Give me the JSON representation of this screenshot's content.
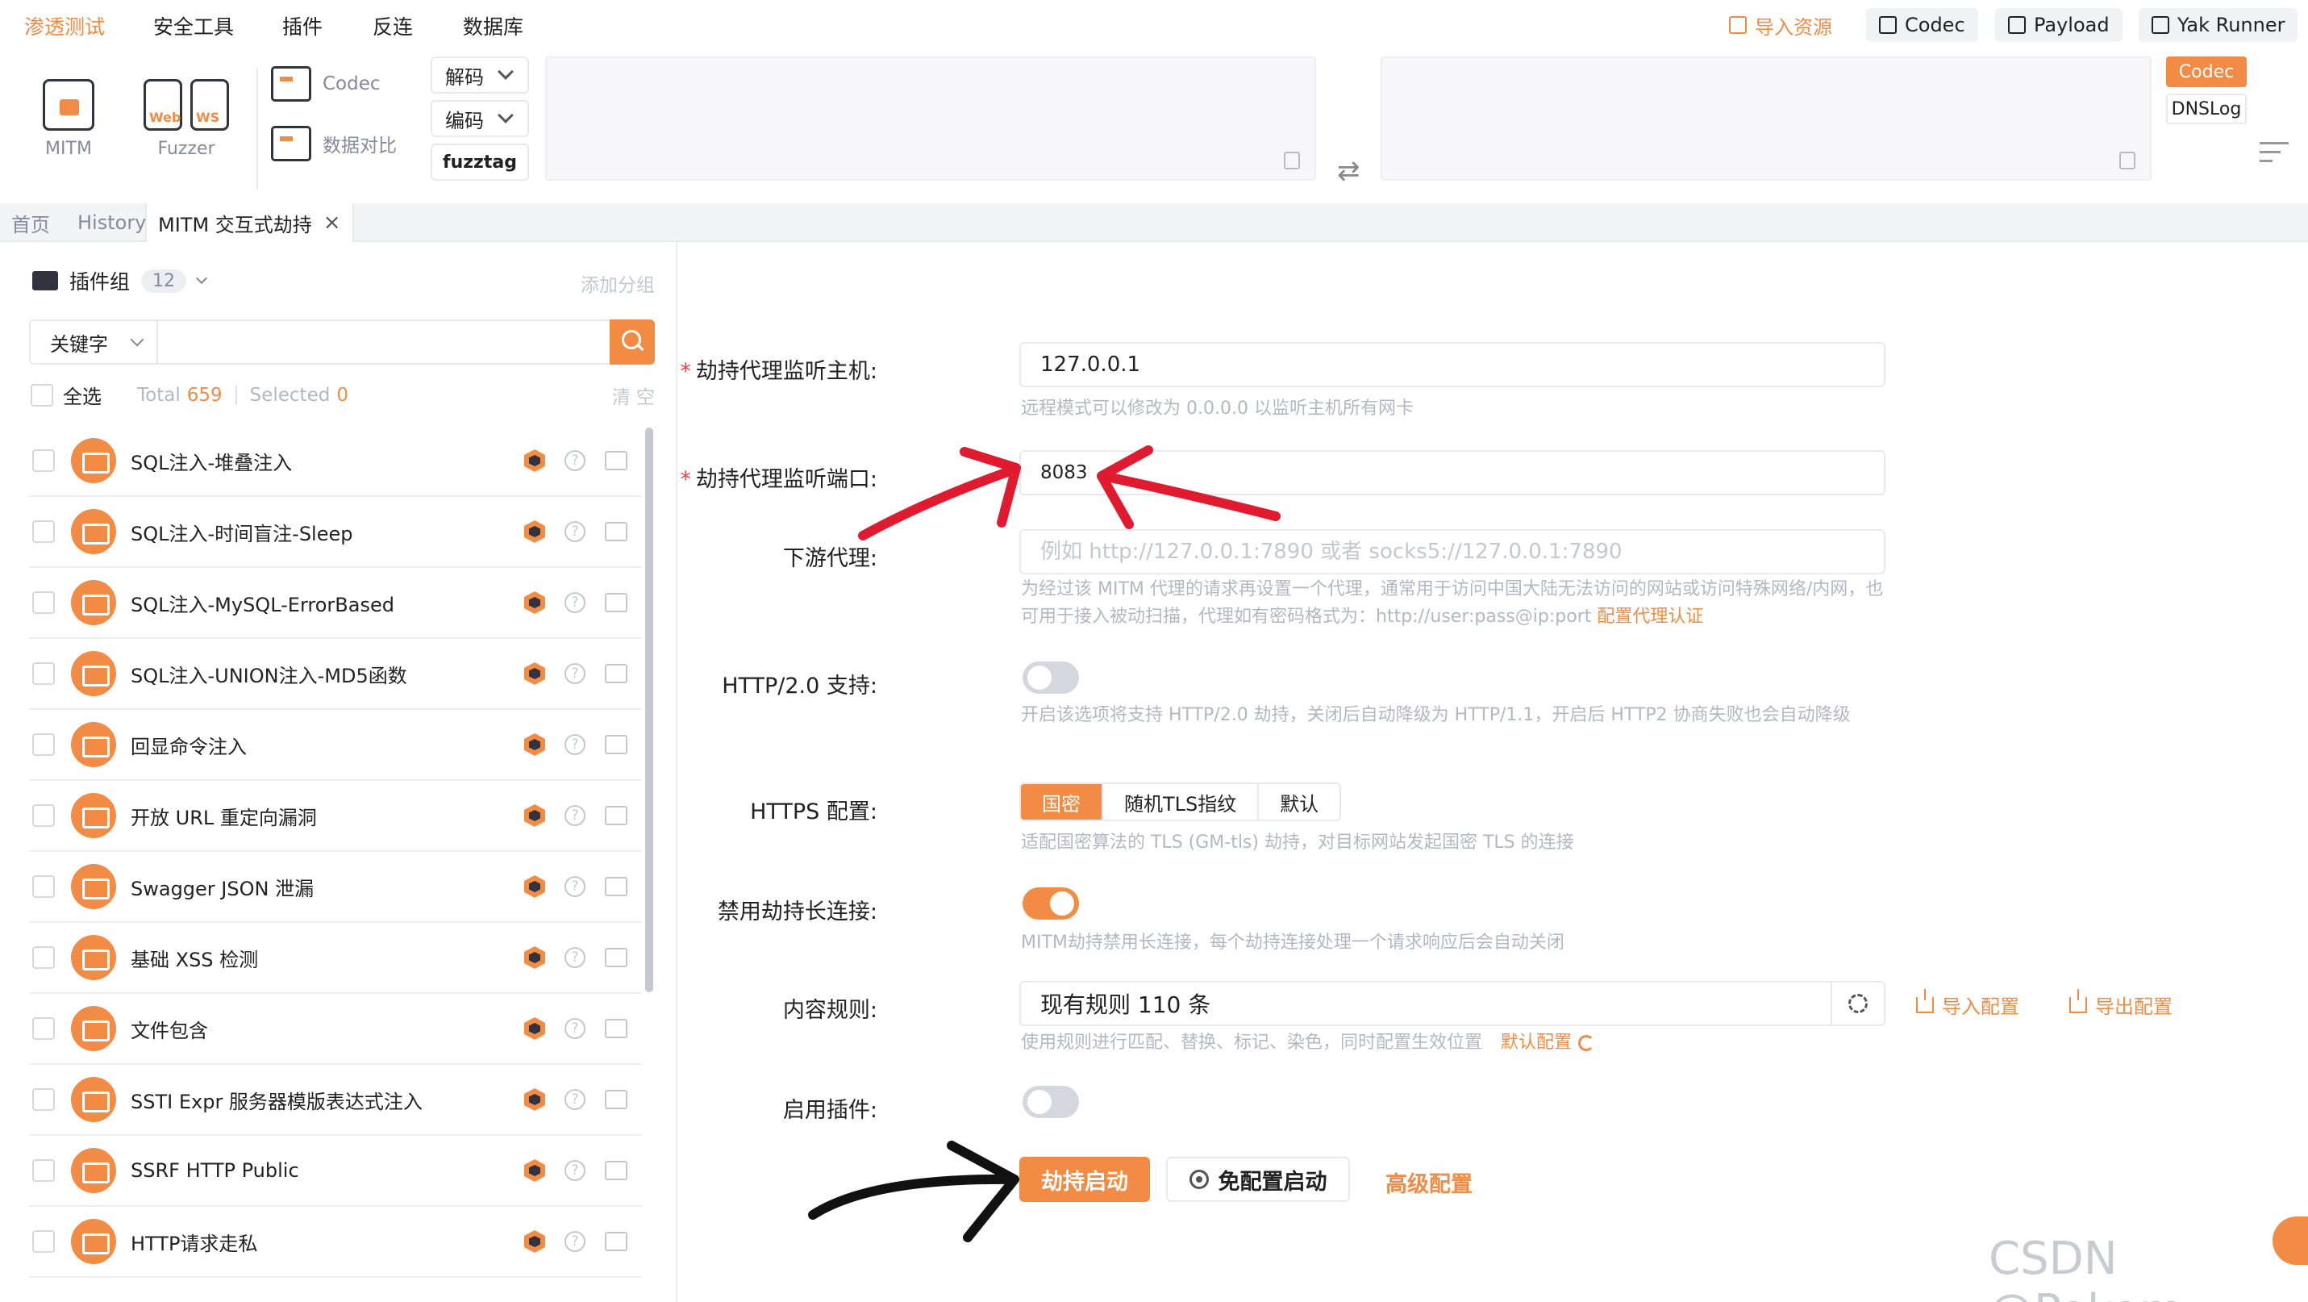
{
  "topnav": {
    "menus": [
      "渗透测试",
      "安全工具",
      "插件",
      "反连",
      "数据库"
    ],
    "quick": {
      "import": "导入资源",
      "codec": "Codec",
      "payload": "Payload",
      "yak_runner": "Yak Runner"
    }
  },
  "toolbar": {
    "mitm": "MITM",
    "fuzzer": "Fuzzer",
    "web_tag": "Web",
    "ws_tag": "WS",
    "codec": "Codec",
    "compare": "数据对比",
    "decode": "解码",
    "encode": "编码",
    "fuzztag": "fuzztag",
    "right_codec": "Codec",
    "right_dnslog": "DNSLog"
  },
  "tabs": {
    "home": "首页",
    "history": "History",
    "mitm": "MITM 交互式劫持",
    "close": "×"
  },
  "plugins": {
    "group_label": "插件组",
    "group_count": "12",
    "add_group": "添加分组",
    "search_type": "关键字",
    "search_value": "",
    "select_all": "全选",
    "total_label": "Total",
    "total": "659",
    "selected_label": "Selected",
    "selected": "0",
    "clear": "清 空",
    "items": [
      "SQL注入-堆叠注入",
      "SQL注入-时间盲注-Sleep",
      "SQL注入-MySQL-ErrorBased",
      "SQL注入-UNION注入-MD5函数",
      "回显命令注入",
      "开放 URL 重定向漏洞",
      "Swagger JSON 泄漏",
      "基础 XSS 检测",
      "文件包含",
      "SSTI Expr 服务器模版表达式注入",
      "SSRF HTTP Public",
      "HTTP请求走私"
    ]
  },
  "form": {
    "host_label": "劫持代理监听主机:",
    "host_value": "127.0.0.1",
    "host_help": "远程模式可以修改为 0.0.0.0 以监听主机所有网卡",
    "port_label": "劫持代理监听端口:",
    "port_value": "8083",
    "downstream_label": "下游代理:",
    "downstream_placeholder": "例如 http://127.0.0.1:7890 或者 socks5://127.0.0.1:7890",
    "downstream_help": "为经过该 MITM 代理的请求再设置一个代理，通常用于访问中国大陆无法访问的网站或访问特殊网络/内网，也可用于接入被动扫描，代理如有密码格式为：http://user:pass@ip:port",
    "downstream_link": "配置代理认证",
    "http2_label": "HTTP/2.0 支持:",
    "http2_help": "开启该选项将支持 HTTP/2.0 劫持，关闭后自动降级为 HTTP/1.1，开启后 HTTP2 协商失败也会自动降级",
    "https_label": "HTTPS 配置:",
    "https_options": [
      "国密",
      "随机TLS指纹",
      "默认"
    ],
    "https_help": "适配国密算法的 TLS (GM-tls) 劫持，对目标网站发起国密 TLS 的连接",
    "keepalive_label": "禁用劫持长连接:",
    "keepalive_help": "MITM劫持禁用长连接，每个劫持连接处理一个请求响应后会自动关闭",
    "rules_label": "内容规则:",
    "rules_value": "现有规则 110 条",
    "rules_import": "导入配置",
    "rules_export": "导出配置",
    "rules_help": "使用规则进行匹配、替换、标记、染色，同时配置生效位置",
    "rules_default": "默认配置",
    "plugin_label": "启用插件:",
    "start": "劫持启动",
    "free_start": "免配置启动",
    "advanced": "高级配置"
  },
  "watermark": "CSDN @Pokem",
  "colors": {
    "accent": "#f28b44",
    "annotation_red": "#e01b2f",
    "annotation_black": "#111111"
  }
}
